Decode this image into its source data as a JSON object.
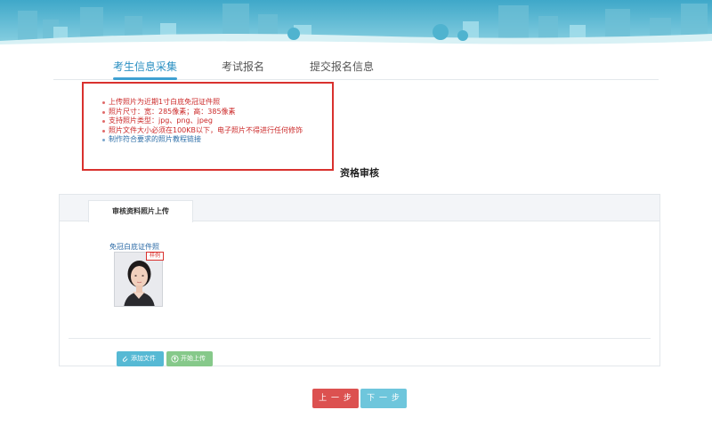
{
  "tabs": [
    {
      "label": "考生信息采集",
      "active": true
    },
    {
      "label": "考试报名",
      "active": false
    },
    {
      "label": "提交报名信息",
      "active": false
    }
  ],
  "notes": [
    "上传照片为近期1寸白底免冠证件照",
    "照片尺寸：宽：285像素；高：385像素",
    "支持照片类型：jpg、png、jpeg",
    "照片文件大小必须在100KB以下，电子照片不得进行任何修饰",
    "制作符合要求的照片教程链接"
  ],
  "section_title": "资格审核",
  "upload_panel": {
    "tab_label": "审核资料照片上传",
    "photo_label": "免冠白底证件照",
    "sample_tag": "样例",
    "add_file_label": "添加文件",
    "start_upload_label": "开始上传"
  },
  "nav": {
    "prev_label": "上 一 步",
    "next_label": "下 一 步"
  },
  "colors": {
    "accent": "#3ea0d2",
    "warning_red": "#d9312e",
    "prev_button": "#dc5150",
    "next_button": "#6ec6dc",
    "add_button": "#56b9d4",
    "upload_button": "#86c98a"
  }
}
